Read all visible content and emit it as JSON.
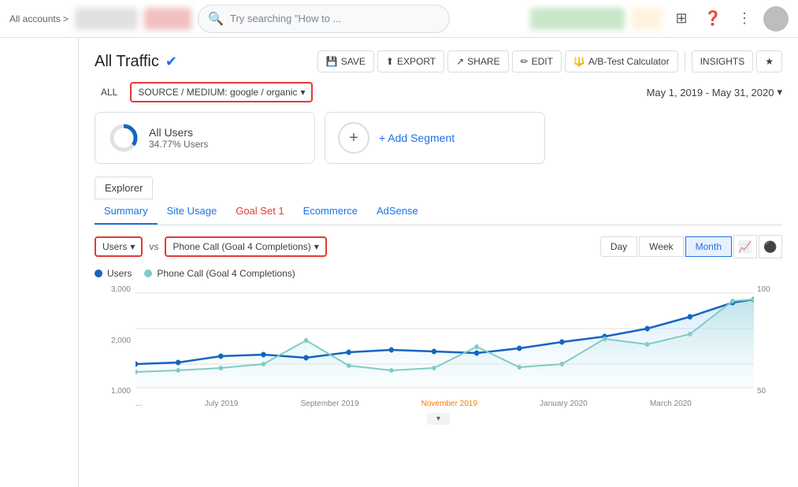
{
  "nav": {
    "accounts_label": "All accounts",
    "accounts_arrow": ">",
    "search_placeholder": "Try searching \"How to ...",
    "grid_icon": "⋮⋮",
    "help_icon": "?",
    "more_icon": "⋮"
  },
  "page": {
    "title": "All Traffic",
    "check_icon": "✔"
  },
  "toolbar": {
    "save": "SAVE",
    "export": "EXPORT",
    "share": "SHARE",
    "edit": "EDIT",
    "ab_test": "A/B-Test Calculator",
    "insights": "INSIGHTS"
  },
  "filter": {
    "all_label": "ALL",
    "source_medium": "SOURCE / MEDIUM: google / organic",
    "date_range": "May 1, 2019 - May 31, 2020"
  },
  "segments": [
    {
      "name": "All Users",
      "sub": "34.77% Users"
    }
  ],
  "add_segment_label": "+ Add Segment",
  "tabs": {
    "explorer": "Explorer",
    "subtabs": [
      "Summary",
      "Site Usage",
      "Goal Set 1",
      "Ecommerce",
      "AdSense"
    ]
  },
  "chart": {
    "metric1": "Users",
    "metric2": "Phone Call (Goal 4 Completions)",
    "period_day": "Day",
    "period_week": "Week",
    "period_month": "Month",
    "legend": [
      {
        "label": "Users",
        "color": "#1565c0"
      },
      {
        "label": "Phone Call (Goal 4 Completions)",
        "color": "#80cbc4"
      }
    ],
    "y_left": [
      "3,000",
      "2,000",
      "1,000"
    ],
    "y_right": [
      "100",
      "50"
    ],
    "x_labels": [
      "...",
      "July 2019",
      "September 2019",
      "November 2019",
      "January 2020",
      "March 2020",
      ""
    ],
    "nov_label": "November 2019"
  }
}
